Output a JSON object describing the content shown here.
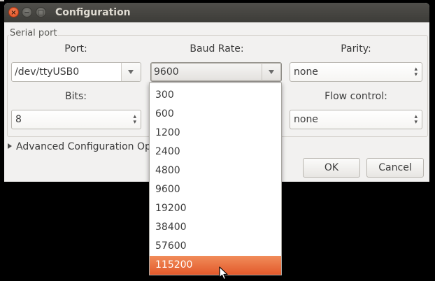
{
  "window": {
    "title": "Configuration",
    "close_glyph": "×",
    "minimize_glyph": "−",
    "maximize_glyph": "□"
  },
  "serial_port": {
    "group_label": "Serial port",
    "port": {
      "label": "Port:",
      "value": "/dev/ttyUSB0"
    },
    "baud_rate": {
      "label": "Baud Rate:",
      "value": "9600"
    },
    "parity": {
      "label": "Parity:",
      "value": "none"
    },
    "bits": {
      "label": "Bits:",
      "value": "8"
    },
    "flow_control": {
      "label": "Flow control:",
      "value": "none"
    }
  },
  "advanced": {
    "label": "Advanced Configuration Opt"
  },
  "buttons": {
    "ok": "OK",
    "cancel": "Cancel"
  },
  "baud_dropdown": {
    "options": [
      "300",
      "600",
      "1200",
      "2400",
      "4800",
      "9600",
      "19200",
      "38400",
      "57600",
      "115200"
    ],
    "highlighted": "115200"
  },
  "colors": {
    "highlight": "#e2592b",
    "titlebar": "#3d3c38",
    "window_bg": "#f2f1f0"
  },
  "icons": {
    "close": "close-icon",
    "minimize": "minimize-icon",
    "maximize": "maximize-icon",
    "dropdown_arrow": "chevron-down-icon",
    "spinner": "updown-icon",
    "expander": "triangle-right-icon",
    "cursor": "mouse-pointer-icon"
  }
}
